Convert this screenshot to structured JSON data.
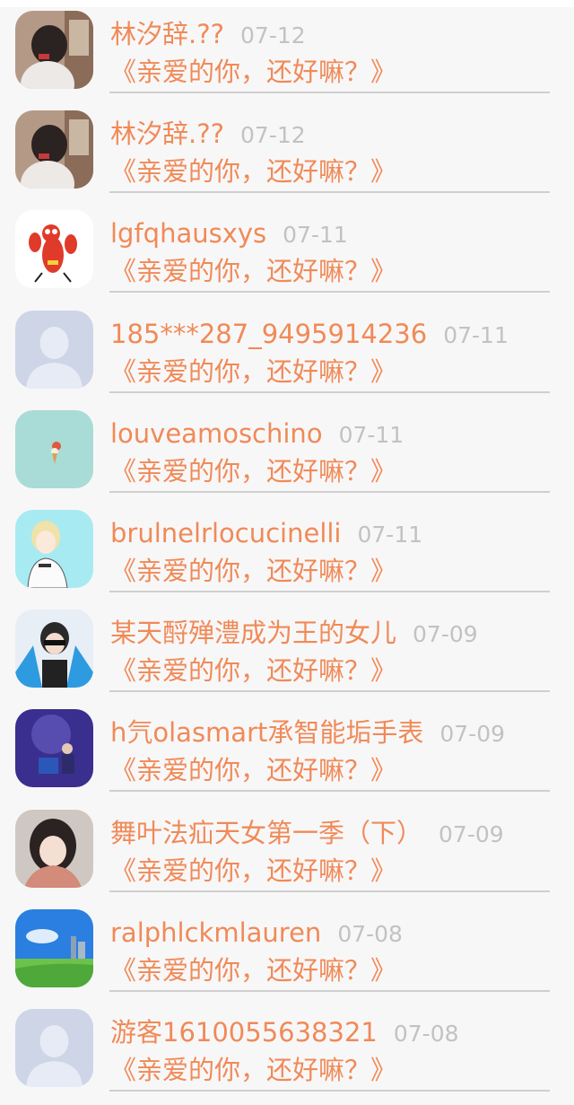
{
  "items": [
    {
      "name": "林汐辞.??",
      "date": "07-12",
      "message": "《亲爱的你，还好嘛？》",
      "avatar": "girl-photo-avatar"
    },
    {
      "name": "林汐辞.??",
      "date": "07-12",
      "message": "《亲爱的你，还好嘛？》",
      "avatar": "girl-photo-avatar"
    },
    {
      "name": "lgfqhausxys",
      "date": "07-11",
      "message": "《亲爱的你，还好嘛？》",
      "avatar": "lobster-cartoon-avatar"
    },
    {
      "name": "185***287_9495914236",
      "date": "07-11",
      "message": "《亲爱的你，还好嘛？》",
      "avatar": "default-person-avatar"
    },
    {
      "name": "louveamoschino",
      "date": "07-11",
      "message": "《亲爱的你，还好嘛？》",
      "avatar": "icecream-avatar"
    },
    {
      "name": "brulnelrlocucinelli",
      "date": "07-11",
      "message": "《亲爱的你，还好嘛？》",
      "avatar": "anime-boy-avatar"
    },
    {
      "name": "某天酹殚澧成为王的女儿",
      "date": "07-09",
      "message": "《亲爱的你，还好嘛？》",
      "avatar": "boy-sunglasses-avatar"
    },
    {
      "name": "h氕olasmart承智能垢手表",
      "date": "07-09",
      "message": "《亲爱的你，还好嘛？》",
      "avatar": "blue-room-avatar"
    },
    {
      "name": "舞叶法疝天女第一季（下）",
      "date": "07-09",
      "message": "《亲爱的你，还好嘛？》",
      "avatar": "girl-selfie-avatar"
    },
    {
      "name": "ralphlckmlauren",
      "date": "07-08",
      "message": "《亲爱的你，还好嘛？》",
      "avatar": "landscape-avatar"
    },
    {
      "name": "游客1610055638321",
      "date": "07-08",
      "message": "《亲爱的你，还好嘛？》",
      "avatar": "default-person-avatar"
    }
  ]
}
